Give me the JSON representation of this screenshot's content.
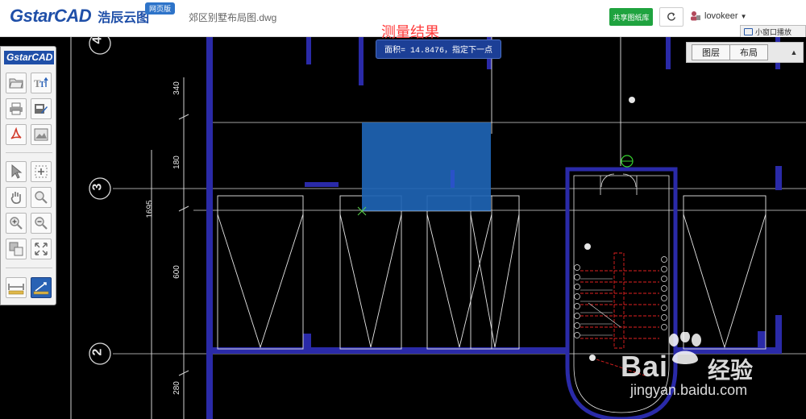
{
  "app": {
    "brand_logo": "GstarCAD",
    "brand_name": "浩辰云图",
    "badge": "网页版",
    "filename": "郊区别墅布局图.dwg"
  },
  "header": {
    "share_label": "共享图纸库",
    "refresh_icon": "refresh-icon",
    "username": "lovokeer",
    "small_window_label": "小窗口播放"
  },
  "measure": {
    "title": "测量结果",
    "result": "面积= 14.8476，指定下一点"
  },
  "tabs": {
    "layers": "图层",
    "layouts": "布局"
  },
  "toolbar": {
    "logo": "GstarCAD",
    "tools": [
      "open-icon",
      "text-style-icon",
      "print-icon",
      "edit-icon",
      "pdf-icon",
      "image-export-icon",
      "select-icon",
      "window-zoom-icon",
      "pan-icon",
      "zoom-realtime-icon",
      "zoom-in-icon",
      "zoom-out-icon",
      "layout-icon",
      "zoom-extents-icon",
      "measure-distance-icon",
      "measure-area-icon"
    ]
  },
  "drawing": {
    "grid_bubbles": [
      "4",
      "3",
      "2"
    ],
    "dimensions": [
      "340",
      "180",
      "1695",
      "600",
      "280"
    ],
    "colors": {
      "background": "#000000",
      "lines": "#e6e6e6",
      "walls": "#3b3bd8",
      "stair_red": "#e02020",
      "highlight": "#1e64b4",
      "marker": "#36d12e"
    }
  },
  "watermark": {
    "brand": "Bai",
    "suffix": "经验",
    "url": "jingyan.baidu.com"
  }
}
